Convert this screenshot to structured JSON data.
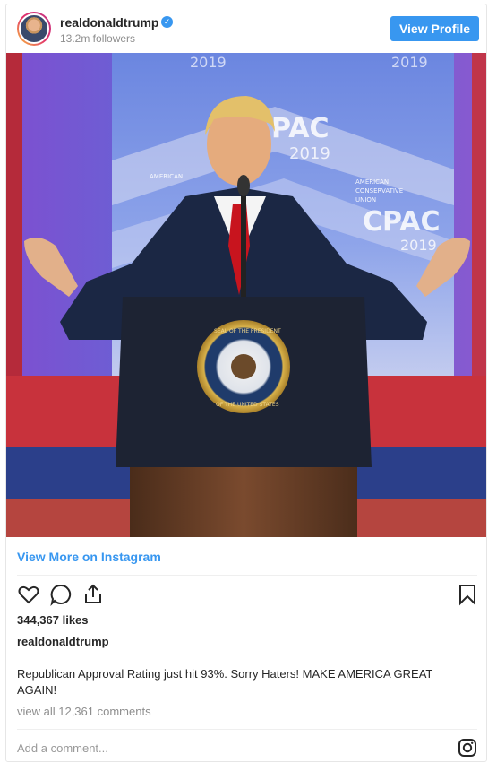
{
  "header": {
    "username": "realdonaldtrump",
    "followers": "13.2m followers",
    "view_profile": "View Profile",
    "verified_icon": "verified-badge-icon"
  },
  "photo": {
    "backdrop_texts": [
      "2019",
      "CPAC",
      "AMERICAN CONSERVATIVE UNION",
      "2019"
    ],
    "seal_text": "SEAL OF THE PRESIDENT OF THE UNITED STATES"
  },
  "links": {
    "view_more": "View More on Instagram"
  },
  "actions": {
    "icons": [
      "heart-icon",
      "comment-icon",
      "share-icon",
      "bookmark-icon"
    ]
  },
  "post": {
    "likes": "344,367 likes",
    "author": "realdonaldtrump",
    "caption": "Republican Approval Rating just hit 93%. Sorry Haters! MAKE AMERICA GREAT AGAIN!",
    "view_comments": "view all 12,361 comments"
  },
  "comment_box": {
    "placeholder": "Add a comment..."
  },
  "colors": {
    "accent": "#3897f0",
    "text": "#262626",
    "muted": "#8e8e8e"
  }
}
